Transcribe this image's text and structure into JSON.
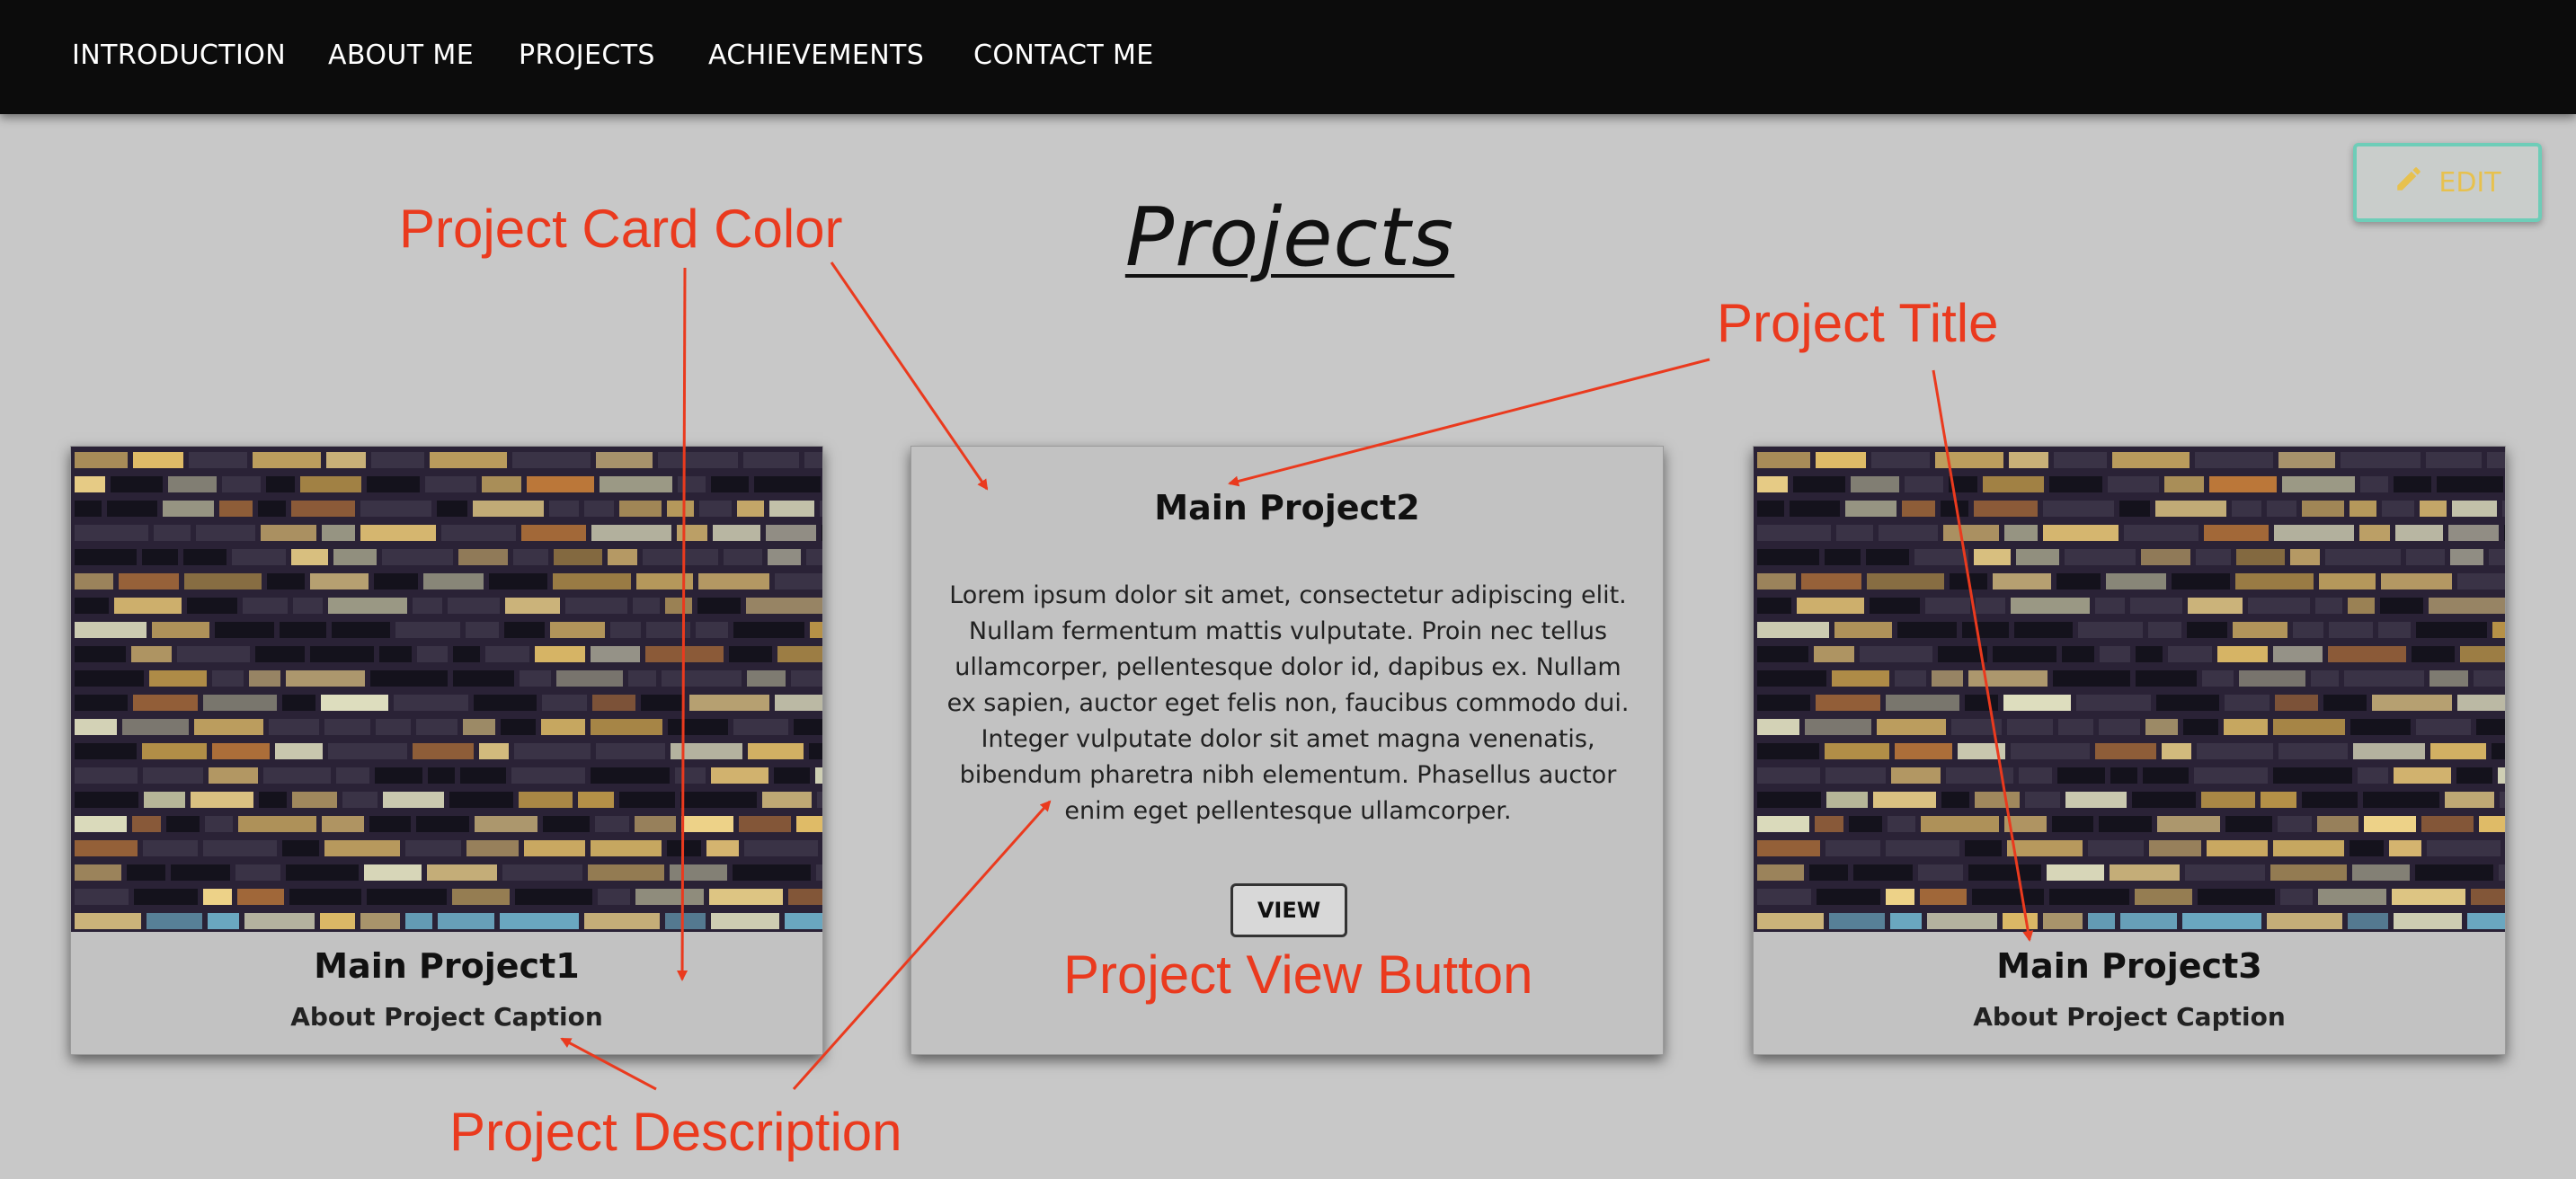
{
  "nav": {
    "items": [
      "INTRODUCTION",
      "ABOUT ME",
      "PROJECTS",
      "ACHIEVEMENTS",
      "CONTACT ME"
    ]
  },
  "edit_button": {
    "label": "EDIT",
    "icon": "pencil-icon",
    "border_color": "#6ecdb8",
    "text_color": "#e7c14e"
  },
  "page_title": "Projects",
  "cards": [
    {
      "title": "Main Project1",
      "caption": "About Project Caption",
      "image": "night-building-windows"
    },
    {
      "title": "Main Project2",
      "description": "Lorem ipsum dolor sit amet, consectetur adipiscing elit. Nullam fermentum mattis vulputate. Proin nec tellus ullamcorper, pellentesque dolor id, dapibus ex. Nullam ex sapien, auctor eget felis non, faucibus commodo dui. Integer vulputate dolor sit amet magna venenatis, bibendum pharetra nibh elementum. Phasellus auctor enim eget pellentesque ullamcorper.",
      "button_label": "VIEW"
    },
    {
      "title": "Main Project3",
      "caption": "About Project Caption",
      "image": "night-building-windows"
    }
  ],
  "annotations": {
    "card_color": "Project Card Color",
    "title": "Project Title",
    "view_button": "Project View Button",
    "description": "Project Description",
    "color": "#ea3a1e"
  },
  "colors": {
    "background": "#c8c8c8",
    "navbar": "#0c0c0c",
    "card": "#c2c2c2"
  }
}
